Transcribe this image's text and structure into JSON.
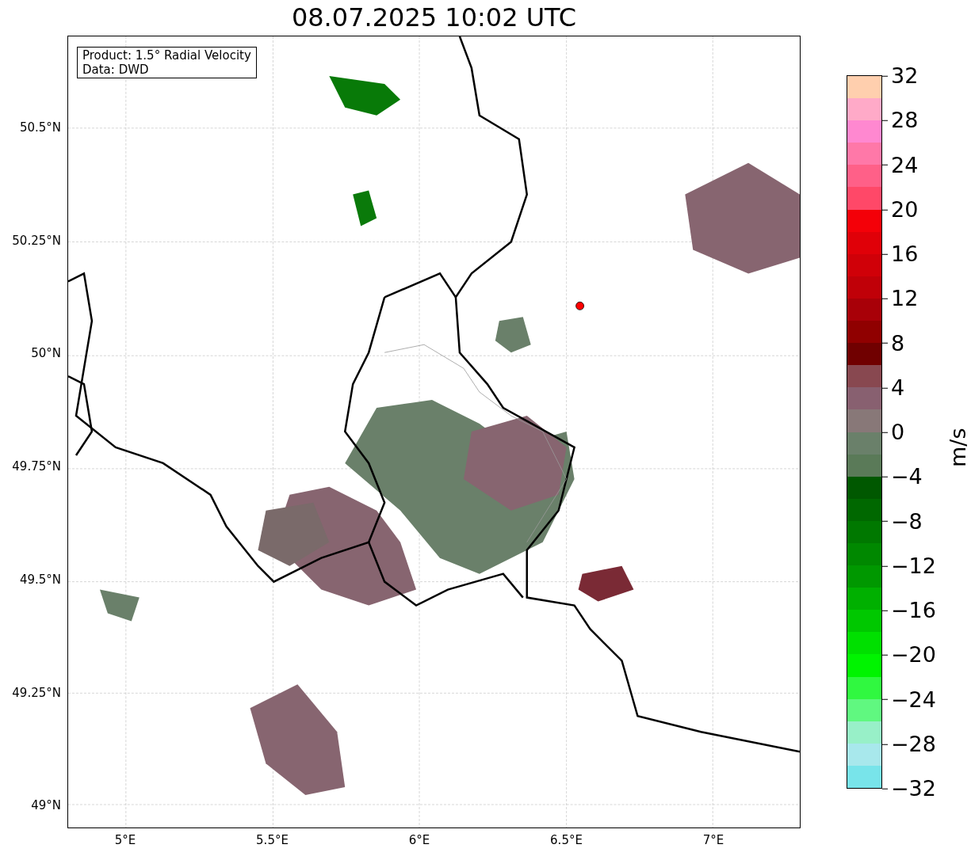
{
  "title": "08.07.2025 10:02 UTC",
  "legend": {
    "lines": [
      "Product: 1.5° Radial Velocity",
      "Data: DWD"
    ]
  },
  "map": {
    "y_ticks": [
      "50.5°N",
      "50.25°N",
      "50°N",
      "49.75°N",
      "49.5°N",
      "49.25°N",
      "49°N"
    ],
    "x_ticks": [
      "5°E",
      "5.5°E",
      "6°E",
      "6.5°E",
      "7°E"
    ]
  },
  "colorbar": {
    "label": "m/s",
    "ticks": [
      "32",
      "28",
      "24",
      "20",
      "16",
      "12",
      "8",
      "4",
      "0",
      "−4",
      "−8",
      "−12",
      "−16",
      "−20",
      "−24",
      "−28",
      "−32"
    ],
    "segments": [
      {
        "color": "#ffcfae"
      },
      {
        "color": "#ffaac8"
      },
      {
        "color": "#ff88d0"
      },
      {
        "color": "#ff78a8"
      },
      {
        "color": "#ff6088"
      },
      {
        "color": "#ff4868"
      },
      {
        "color": "#f40008"
      },
      {
        "color": "#e00008"
      },
      {
        "color": "#d00008"
      },
      {
        "color": "#c00008"
      },
      {
        "color": "#a80008"
      },
      {
        "color": "#900000"
      },
      {
        "color": "#700000"
      },
      {
        "color": "#884850"
      },
      {
        "color": "#886070"
      },
      {
        "color": "#887878"
      },
      {
        "color": "#6a806a"
      },
      {
        "color": "#5a7a58"
      },
      {
        "color": "#005800"
      },
      {
        "color": "#006800"
      },
      {
        "color": "#007800"
      },
      {
        "color": "#008800"
      },
      {
        "color": "#009800"
      },
      {
        "color": "#00b000"
      },
      {
        "color": "#00c800"
      },
      {
        "color": "#00e000"
      },
      {
        "color": "#00f400"
      },
      {
        "color": "#30f840"
      },
      {
        "color": "#60f880"
      },
      {
        "color": "#98f0c8"
      },
      {
        "color": "#a8e8ec"
      },
      {
        "color": "#78e4ea"
      }
    ]
  }
}
